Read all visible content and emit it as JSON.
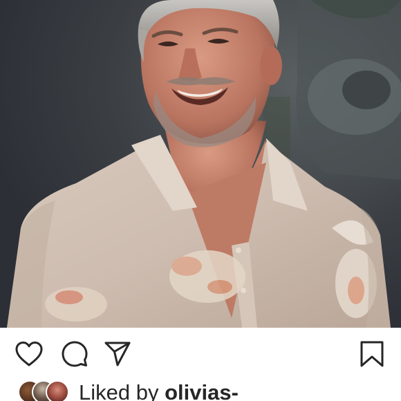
{
  "post": {
    "image": {
      "subject": "man-in-floral-shirt"
    }
  },
  "actions": {
    "like_icon": "heart-outline",
    "comment_icon": "speech-bubble-outline",
    "share_icon": "paper-plane-outline",
    "save_icon": "bookmark-outline"
  },
  "likes": {
    "prefix": "Liked by",
    "user": "olivias-",
    "avatars": [
      "avatar-1",
      "avatar-2",
      "avatar-3"
    ]
  },
  "colors": {
    "text": "#262626",
    "icon": "#262626",
    "background": "#ffffff"
  }
}
